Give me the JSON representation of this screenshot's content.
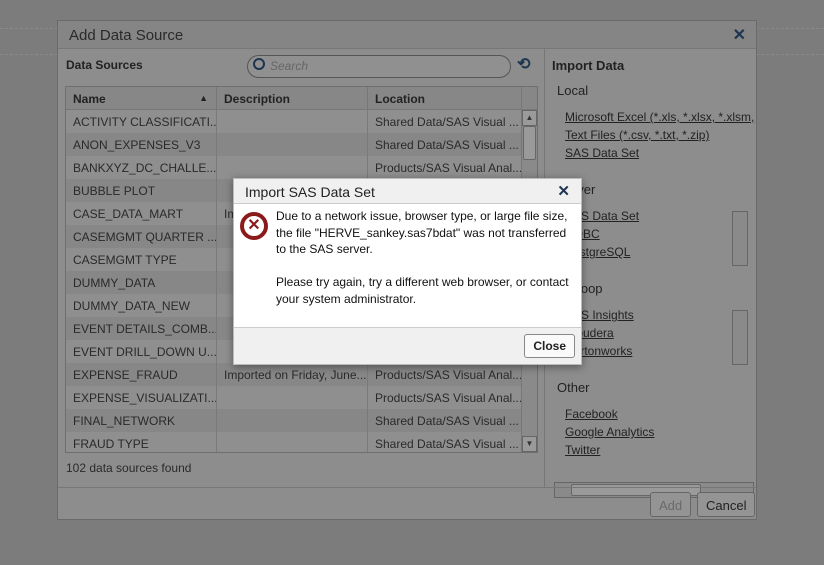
{
  "dialog": {
    "title": "Add Data Source",
    "data_sources_label": "Data Sources",
    "search_placeholder": "Search",
    "columns": [
      "Name",
      "Description",
      "Location"
    ],
    "rows": [
      [
        "ACTIVITY CLASSIFICATI...",
        "",
        "Shared Data/SAS Visual ..."
      ],
      [
        "ANON_EXPENSES_V3",
        "",
        "Shared Data/SAS Visual ..."
      ],
      [
        "BANKXYZ_DC_CHALLE...",
        "",
        "Products/SAS Visual Anal..."
      ],
      [
        "BUBBLE PLOT",
        "",
        ""
      ],
      [
        "CASE_DATA_MART",
        "Im",
        ""
      ],
      [
        "CASEMGMT QUARTER ...",
        "",
        ""
      ],
      [
        "CASEMGMT TYPE",
        "",
        ""
      ],
      [
        "DUMMY_DATA",
        "",
        ""
      ],
      [
        "DUMMY_DATA_NEW",
        "",
        ""
      ],
      [
        "EVENT DETAILS_COMB...",
        "",
        ""
      ],
      [
        "EVENT DRILL_DOWN U...",
        "",
        ""
      ],
      [
        "EXPENSE_FRAUD",
        "Imported on Friday, June...",
        "Products/SAS Visual Anal..."
      ],
      [
        "EXPENSE_VISUALIZATI...",
        "",
        "Products/SAS Visual Anal..."
      ],
      [
        "FINAL_NETWORK",
        "",
        "Shared Data/SAS Visual ..."
      ],
      [
        "FRAUD TYPE",
        "",
        "Shared Data/SAS Visual ..."
      ]
    ],
    "count": "102 data sources found",
    "import": {
      "title": "Import Data",
      "local": {
        "label": "Local",
        "items": [
          "Microsoft Excel (*.xls, *.xlsx, *.xlsm,",
          "Text Files (*.csv, *.txt, *.zip)",
          "SAS Data Set"
        ]
      },
      "server": {
        "label": "Server",
        "items": [
          "SAS Data Set",
          "ODBC",
          "PostgreSQL"
        ]
      },
      "hadoop": {
        "label": "Hadoop",
        "items": [
          "SAS Insights",
          "Cloudera",
          "Hortonworks"
        ]
      },
      "other": {
        "label": "Other",
        "items": [
          "Facebook",
          "Google Analytics",
          "Twitter"
        ]
      }
    },
    "add_label": "Add",
    "cancel_label": "Cancel"
  },
  "modal": {
    "title": "Import SAS Data Set",
    "message1": "Due to a network issue, browser type, or large file size, the file \"HERVE_sankey.sas7bdat\" was not transferred to the SAS server.",
    "message2": "Please try again, try a different web browser, or contact your system administrator.",
    "close_label": "Close"
  }
}
